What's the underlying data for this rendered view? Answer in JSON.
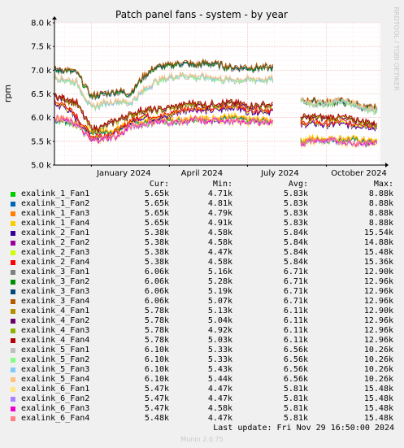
{
  "chart_data": {
    "type": "line",
    "title": "Patch panel fans - system - by year",
    "ylabel": "rpm",
    "side_label": "RRDTOOL / TOBI OETIKER",
    "ylim": [
      5000,
      8000
    ],
    "yticks": [
      {
        "v": 5000,
        "label": "5.0 k"
      },
      {
        "v": 5500,
        "label": "5.5 k"
      },
      {
        "v": 6000,
        "label": "6.0 k"
      },
      {
        "v": 6500,
        "label": "6.5 k"
      },
      {
        "v": 7000,
        "label": "7.0 k"
      },
      {
        "v": 7500,
        "label": "7.5 k"
      },
      {
        "v": 8000,
        "label": "8.0 k"
      }
    ],
    "xlim": [
      "2023-11-19",
      "2024-12-03"
    ],
    "xticks": [
      {
        "v": "2024-01-01",
        "label": "January 2024"
      },
      {
        "v": "2024-04-01",
        "label": "April 2024"
      },
      {
        "v": "2024-07-01",
        "label": "July 2024"
      },
      {
        "v": "2024-10-01",
        "label": "October 2024"
      }
    ],
    "x": [
      "2023-11-19",
      "2023-12-01",
      "2023-12-15",
      "2024-01-01",
      "2024-01-15",
      "2024-02-01",
      "2024-02-15",
      "2024-03-01",
      "2024-03-15",
      "2024-04-01",
      "2024-04-15",
      "2024-05-01",
      "2024-05-15",
      "2024-06-01",
      "2024-06-15",
      "2024-07-01",
      "2024-07-15",
      "2024-08-01",
      "2024-08-15",
      "2024-09-01",
      "2024-09-15",
      "2024-10-01",
      "2024-10-15",
      "2024-11-01",
      "2024-11-15",
      "2024-11-29"
    ],
    "series_groups": [
      {
        "name": "exalink_1",
        "values": [
          5.95,
          5.95,
          5.85,
          5.7,
          5.7,
          5.75,
          5.9,
          5.9,
          5.95,
          5.95,
          5.95,
          6.0,
          5.95,
          6.0,
          6.0,
          5.95,
          5.95,
          5.95,
          null,
          5.5,
          5.55,
          5.55,
          5.55,
          5.55,
          5.5,
          5.5
        ]
      },
      {
        "name": "exalink_2",
        "values": [
          6.3,
          6.25,
          6.0,
          5.6,
          5.6,
          5.7,
          5.9,
          6.05,
          6.0,
          6.05,
          6.15,
          6.2,
          6.15,
          6.2,
          6.25,
          6.15,
          6.15,
          6.15,
          null,
          5.85,
          5.9,
          5.85,
          5.9,
          5.85,
          5.85,
          5.8
        ]
      },
      {
        "name": "exalink_3",
        "values": [
          7.0,
          7.0,
          6.95,
          6.45,
          6.5,
          6.55,
          6.5,
          6.85,
          7.05,
          7.1,
          7.15,
          7.1,
          7.15,
          7.1,
          7.05,
          7.05,
          7.05,
          7.05,
          null,
          6.35,
          6.35,
          6.3,
          6.35,
          6.3,
          6.2,
          6.2
        ]
      },
      {
        "name": "exalink_4",
        "values": [
          6.45,
          6.4,
          6.3,
          5.75,
          5.8,
          5.95,
          6.05,
          6.15,
          6.15,
          6.2,
          6.25,
          6.3,
          6.25,
          6.3,
          6.3,
          6.25,
          6.25,
          6.25,
          null,
          6.0,
          6.0,
          6.0,
          6.0,
          5.95,
          5.9,
          5.85
        ]
      },
      {
        "name": "exalink_5",
        "values": [
          6.85,
          6.8,
          6.75,
          6.2,
          6.3,
          6.35,
          6.3,
          6.55,
          6.75,
          6.85,
          6.9,
          6.85,
          6.85,
          6.8,
          6.8,
          6.8,
          6.8,
          6.8,
          null,
          6.35,
          6.3,
          6.3,
          6.35,
          6.3,
          6.2,
          6.15
        ]
      },
      {
        "name": "exalink_6",
        "values": [
          6.0,
          5.95,
          5.85,
          5.5,
          5.55,
          5.6,
          5.8,
          5.85,
          5.9,
          5.9,
          5.9,
          5.95,
          5.9,
          5.95,
          5.9,
          5.9,
          5.9,
          5.9,
          null,
          5.45,
          5.5,
          5.5,
          5.5,
          5.45,
          5.45,
          5.45
        ]
      }
    ],
    "legend_columns": {
      "cur": "Cur:",
      "min": "Min:",
      "avg": "Avg:",
      "max": "Max:"
    },
    "legend": [
      {
        "name": "exalink_1_Fan1",
        "color": "#00cc00",
        "group": 0,
        "cur": "5.65k",
        "min": "4.71k",
        "avg": "5.83k",
        "max": "8.88k"
      },
      {
        "name": "exalink_1_Fan2",
        "color": "#0066b3",
        "group": 0,
        "cur": "5.65k",
        "min": "4.81k",
        "avg": "5.83k",
        "max": "8.88k"
      },
      {
        "name": "exalink_1_Fan3",
        "color": "#ff8000",
        "group": 0,
        "cur": "5.65k",
        "min": "4.79k",
        "avg": "5.83k",
        "max": "8.88k"
      },
      {
        "name": "exalink_1_Fan4",
        "color": "#ffcc00",
        "group": 0,
        "cur": "5.65k",
        "min": "4.91k",
        "avg": "5.83k",
        "max": "8.88k"
      },
      {
        "name": "exalink_2_Fan1",
        "color": "#330099",
        "group": 1,
        "cur": "5.38k",
        "min": "4.58k",
        "avg": "5.84k",
        "max": "15.54k"
      },
      {
        "name": "exalink_2_Fan2",
        "color": "#990099",
        "group": 1,
        "cur": "5.38k",
        "min": "4.58k",
        "avg": "5.84k",
        "max": "14.88k"
      },
      {
        "name": "exalink_2_Fan3",
        "color": "#ccff00",
        "group": 1,
        "cur": "5.38k",
        "min": "4.47k",
        "avg": "5.84k",
        "max": "15.48k"
      },
      {
        "name": "exalink_2_Fan4",
        "color": "#ff0000",
        "group": 1,
        "cur": "5.38k",
        "min": "4.58k",
        "avg": "5.84k",
        "max": "15.36k"
      },
      {
        "name": "exalink_3_Fan1",
        "color": "#808080",
        "group": 2,
        "cur": "6.06k",
        "min": "5.16k",
        "avg": "6.71k",
        "max": "12.90k"
      },
      {
        "name": "exalink_3_Fan2",
        "color": "#008f00",
        "group": 2,
        "cur": "6.06k",
        "min": "5.28k",
        "avg": "6.71k",
        "max": "12.96k"
      },
      {
        "name": "exalink_3_Fan3",
        "color": "#00487d",
        "group": 2,
        "cur": "6.06k",
        "min": "5.19k",
        "avg": "6.71k",
        "max": "12.96k"
      },
      {
        "name": "exalink_3_Fan4",
        "color": "#b35a00",
        "group": 2,
        "cur": "6.06k",
        "min": "5.07k",
        "avg": "6.71k",
        "max": "12.96k"
      },
      {
        "name": "exalink_4_Fan1",
        "color": "#b38f00",
        "group": 3,
        "cur": "5.78k",
        "min": "5.13k",
        "avg": "6.11k",
        "max": "12.90k"
      },
      {
        "name": "exalink_4_Fan2",
        "color": "#6b006b",
        "group": 3,
        "cur": "5.78k",
        "min": "5.04k",
        "avg": "6.11k",
        "max": "12.96k"
      },
      {
        "name": "exalink_4_Fan3",
        "color": "#8fb300",
        "group": 3,
        "cur": "5.78k",
        "min": "4.92k",
        "avg": "6.11k",
        "max": "12.96k"
      },
      {
        "name": "exalink_4_Fan4",
        "color": "#b30000",
        "group": 3,
        "cur": "5.78k",
        "min": "5.03k",
        "avg": "6.11k",
        "max": "12.96k"
      },
      {
        "name": "exalink_5_Fan1",
        "color": "#bebebe",
        "group": 4,
        "cur": "6.10k",
        "min": "5.33k",
        "avg": "6.56k",
        "max": "10.26k"
      },
      {
        "name": "exalink_5_Fan2",
        "color": "#80ff80",
        "group": 4,
        "cur": "6.10k",
        "min": "5.33k",
        "avg": "6.56k",
        "max": "10.26k"
      },
      {
        "name": "exalink_5_Fan3",
        "color": "#80c9ff",
        "group": 4,
        "cur": "6.10k",
        "min": "5.43k",
        "avg": "6.56k",
        "max": "10.26k"
      },
      {
        "name": "exalink_5_Fan4",
        "color": "#ffc080",
        "group": 4,
        "cur": "6.10k",
        "min": "5.44k",
        "avg": "6.56k",
        "max": "10.26k"
      },
      {
        "name": "exalink_6_Fan1",
        "color": "#ffe680",
        "group": 5,
        "cur": "5.47k",
        "min": "4.47k",
        "avg": "5.81k",
        "max": "15.48k"
      },
      {
        "name": "exalink_6_Fan2",
        "color": "#aa80ff",
        "group": 5,
        "cur": "5.47k",
        "min": "4.47k",
        "avg": "5.81k",
        "max": "15.48k"
      },
      {
        "name": "exalink_6_Fan3",
        "color": "#ee00cc",
        "group": 5,
        "cur": "5.47k",
        "min": "4.58k",
        "avg": "5.81k",
        "max": "15.48k"
      },
      {
        "name": "exalink_6_Fan4",
        "color": "#ff8080",
        "group": 5,
        "cur": "5.48k",
        "min": "4.47k",
        "avg": "5.81k",
        "max": "15.48k"
      }
    ],
    "last_update": "Last update: Fri Nov 29 16:50:00 2024",
    "footer": "Munin 2.0.75"
  }
}
